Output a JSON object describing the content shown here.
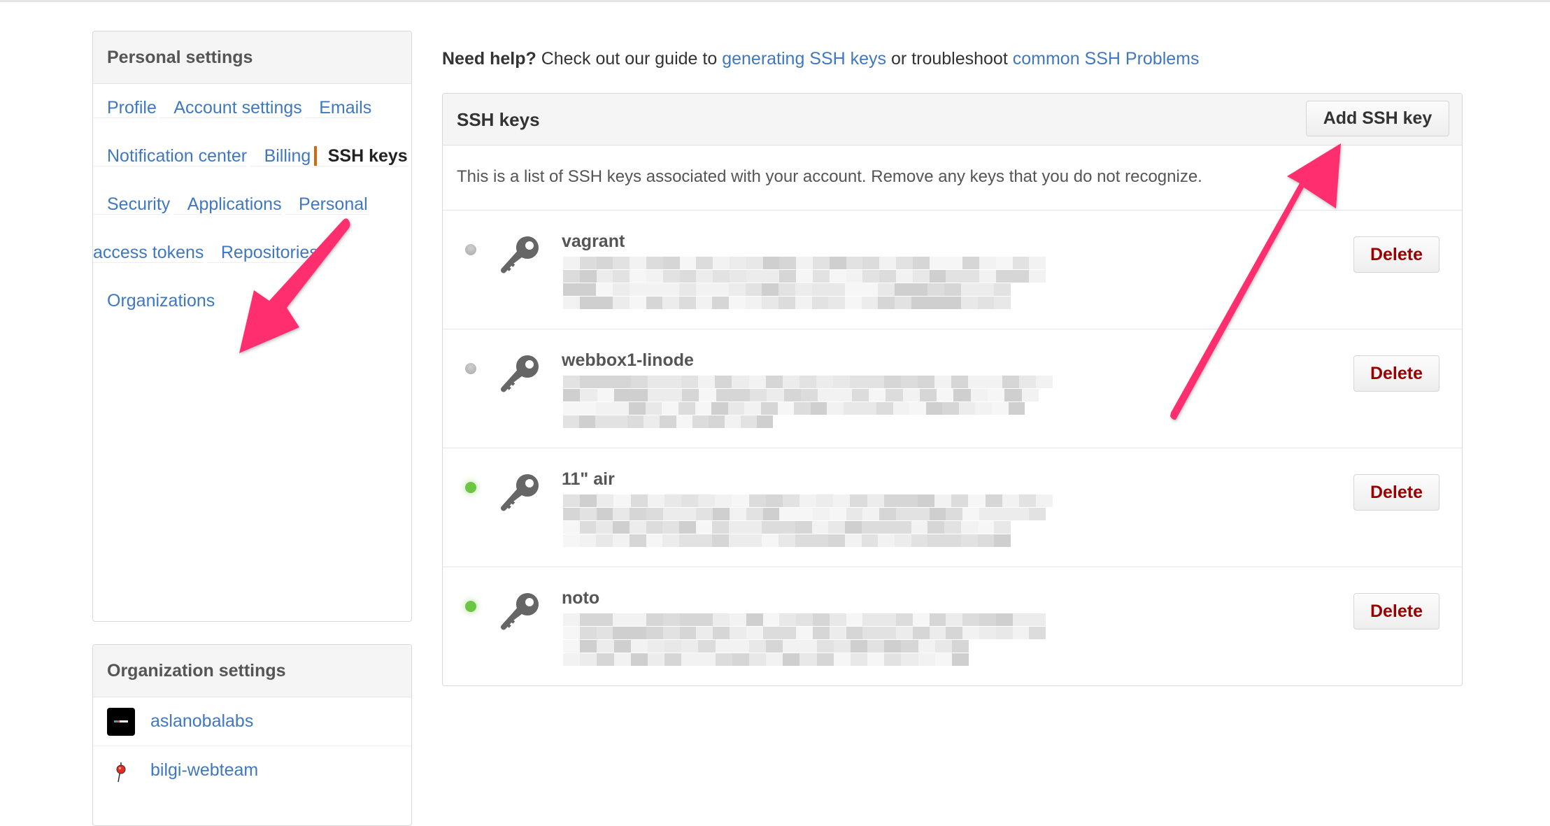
{
  "sidebar": {
    "personal": {
      "heading": "Personal settings",
      "items": [
        {
          "label": "Profile"
        },
        {
          "label": "Account settings"
        },
        {
          "label": "Emails"
        },
        {
          "label": "Notification center"
        },
        {
          "label": "Billing"
        },
        {
          "label": "SSH keys",
          "selected": true
        },
        {
          "label": "Security"
        },
        {
          "label": "Applications"
        },
        {
          "label": "Personal access tokens"
        },
        {
          "label": "Repositories"
        },
        {
          "label": "Organizations"
        }
      ]
    },
    "organization": {
      "heading": "Organization settings",
      "items": [
        {
          "label": "aslanobalabs",
          "avatar": "aslanobalabs-logo"
        },
        {
          "label": "bilgi-webteam",
          "avatar": "pin-logo"
        }
      ]
    }
  },
  "help": {
    "prefix_bold": "Need help?",
    "text_1": " Check out our guide to ",
    "link_1": "generating SSH keys",
    "text_2": " or troubleshoot ",
    "link_2": "common SSH Problems"
  },
  "ssh_keys": {
    "title": "SSH keys",
    "add_button": "Add SSH key",
    "description": "This is a list of SSH keys associated with your account. Remove any keys that you do not recognize.",
    "delete_label": "Delete",
    "keys": [
      {
        "name": "vagrant",
        "status": "inactive",
        "fingerprint": "[redacted / pixelated]"
      },
      {
        "name": "webbox1-linode",
        "status": "inactive",
        "fingerprint": "[redacted / pixelated]"
      },
      {
        "name": "11\" air",
        "status": "active",
        "fingerprint": "[redacted / pixelated]"
      },
      {
        "name": "noto",
        "status": "active",
        "fingerprint": "[redacted / pixelated]"
      }
    ]
  },
  "colors": {
    "link": "#4078c0",
    "selected_marker": "#d26911",
    "delete_text": "#990000",
    "status_active": "#6cc644",
    "status_inactive": "#bbbbbb",
    "annotation_arrow": "#ff2f6e"
  },
  "annotations": [
    {
      "type": "arrow",
      "points_to": "sidebar-item-ssh-keys"
    },
    {
      "type": "arrow",
      "points_to": "add-ssh-key-button"
    }
  ]
}
